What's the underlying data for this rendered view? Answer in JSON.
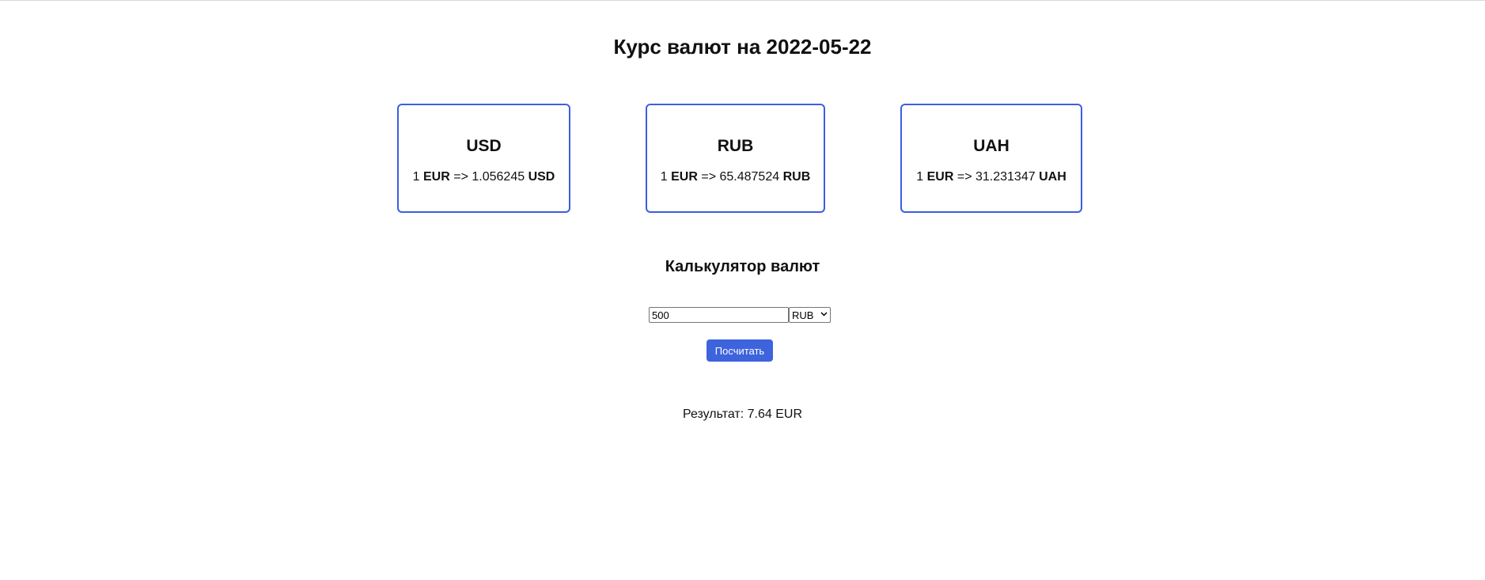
{
  "header": {
    "title": "Курс валют на 2022-05-22"
  },
  "rates": [
    {
      "code": "USD",
      "base_amount": "1",
      "base": "EUR",
      "arrow": "=>",
      "value": "1.056245",
      "target": "USD"
    },
    {
      "code": "RUB",
      "base_amount": "1",
      "base": "EUR",
      "arrow": "=>",
      "value": "65.487524",
      "target": "RUB"
    },
    {
      "code": "UAH",
      "base_amount": "1",
      "base": "EUR",
      "arrow": "=>",
      "value": "31.231347",
      "target": "UAH"
    }
  ],
  "calculator": {
    "title": "Калькулятор валют",
    "amount_value": "500",
    "selected_currency": "RUB",
    "button_label": "Посчитать",
    "result_text": "Результат: 7.64 EUR"
  },
  "colors": {
    "accent": "#3d63dd",
    "card_border": "#3b5fe0"
  },
  "icons": {
    "select_arrow": "chevron-down-icon"
  }
}
